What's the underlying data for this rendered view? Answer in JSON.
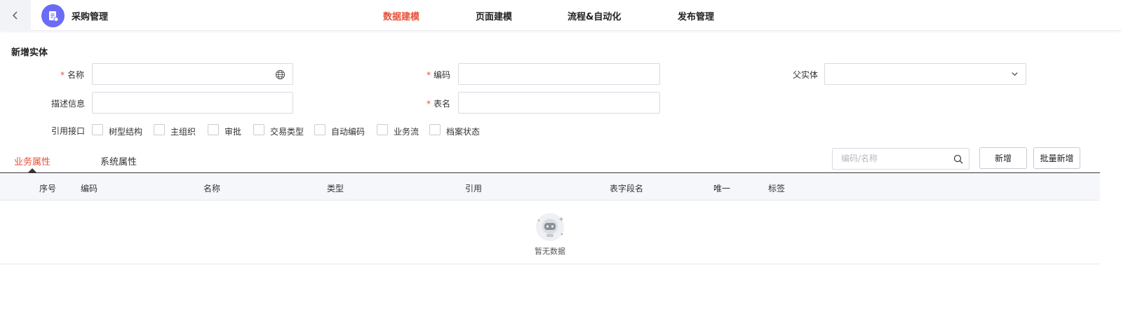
{
  "header": {
    "app_title": "采购管理",
    "nav_tabs": [
      {
        "label": "数据建模",
        "active": true
      },
      {
        "label": "页面建模",
        "active": false
      },
      {
        "label": "流程&自动化",
        "active": false
      },
      {
        "label": "发布管理",
        "active": false
      }
    ]
  },
  "form": {
    "section_title": "新增实体",
    "required_mark": "*",
    "name_label": "名称",
    "code_label": "编码",
    "parent_label": "父实体",
    "desc_label": "描述信息",
    "table_label": "表名",
    "interface_label": "引用接口",
    "name_value": "",
    "code_value": "",
    "parent_value": "",
    "desc_value": "",
    "table_value": "",
    "interfaces": [
      {
        "label": "树型结构",
        "checked": false
      },
      {
        "label": "主组织",
        "checked": false
      },
      {
        "label": "审批",
        "checked": false
      },
      {
        "label": "交易类型",
        "checked": false
      },
      {
        "label": "自动编码",
        "checked": false
      },
      {
        "label": "业务流",
        "checked": false
      },
      {
        "label": "档案状态",
        "checked": false
      }
    ]
  },
  "tabs": {
    "business": "业务属性",
    "system": "系统属性"
  },
  "toolbar": {
    "search_placeholder": "编码/名称",
    "add_label": "新增",
    "batch_add_label": "批量新增"
  },
  "table": {
    "columns": [
      "序号",
      "编码",
      "名称",
      "类型",
      "引用",
      "表字段名",
      "唯一",
      "标签"
    ],
    "rows": [],
    "empty_text": "暂无数据"
  },
  "colors": {
    "accent": "#e8503a",
    "app_icon": "#6b6cf5"
  },
  "icons": [
    "back-chevron-icon",
    "app-document-icon",
    "globe-icon",
    "chevron-down-icon",
    "search-icon",
    "empty-state-icon"
  ]
}
